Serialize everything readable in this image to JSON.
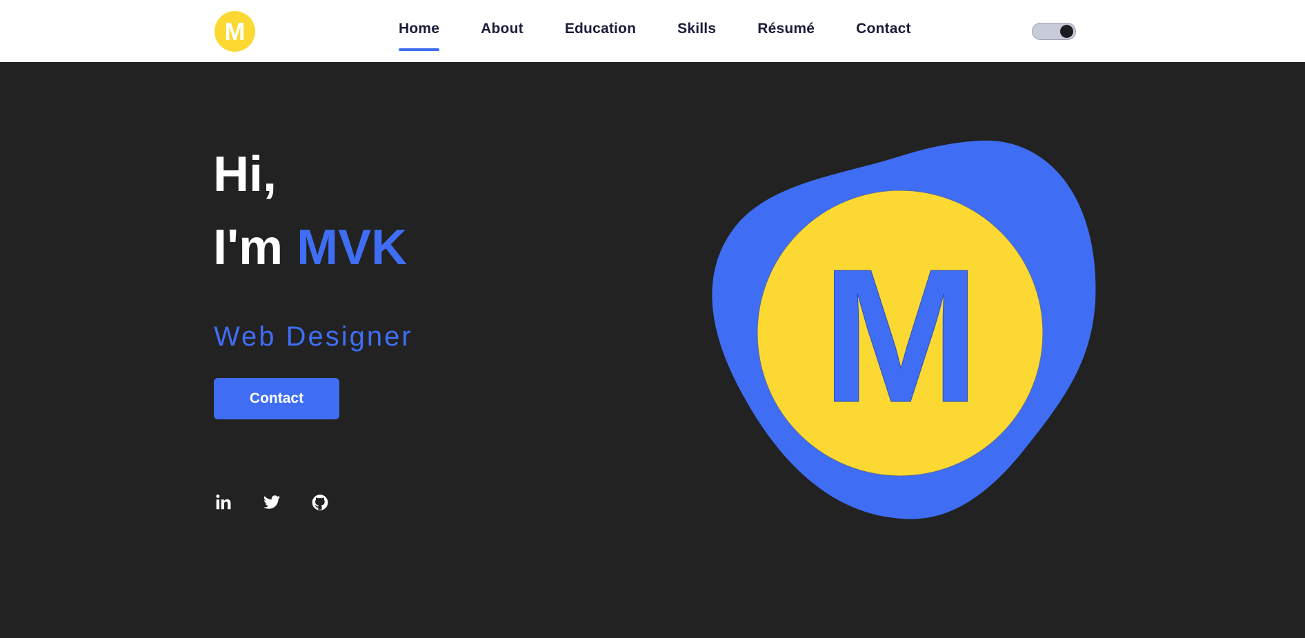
{
  "header": {
    "logo_letter": "M",
    "nav": [
      {
        "label": "Home",
        "active": true
      },
      {
        "label": "About"
      },
      {
        "label": "Education"
      },
      {
        "label": "Skills"
      },
      {
        "label": "Résumé"
      },
      {
        "label": "Contact"
      }
    ],
    "theme_toggle": {
      "state": "on"
    }
  },
  "hero": {
    "greeting": "Hi,",
    "intro_prefix": "I'm",
    "name": "MVK",
    "role": "Web Designer",
    "contact_button": "Contact",
    "socials": [
      "linkedin-icon",
      "twitter-icon",
      "github-icon"
    ]
  },
  "illustration": {
    "letter": "M"
  },
  "colors": {
    "accent_blue": "#3f6ef5",
    "accent_yellow": "#fcd932",
    "background_dark": "#222222",
    "header_bg": "#ffffff",
    "nav_text": "#1b1c3a"
  }
}
